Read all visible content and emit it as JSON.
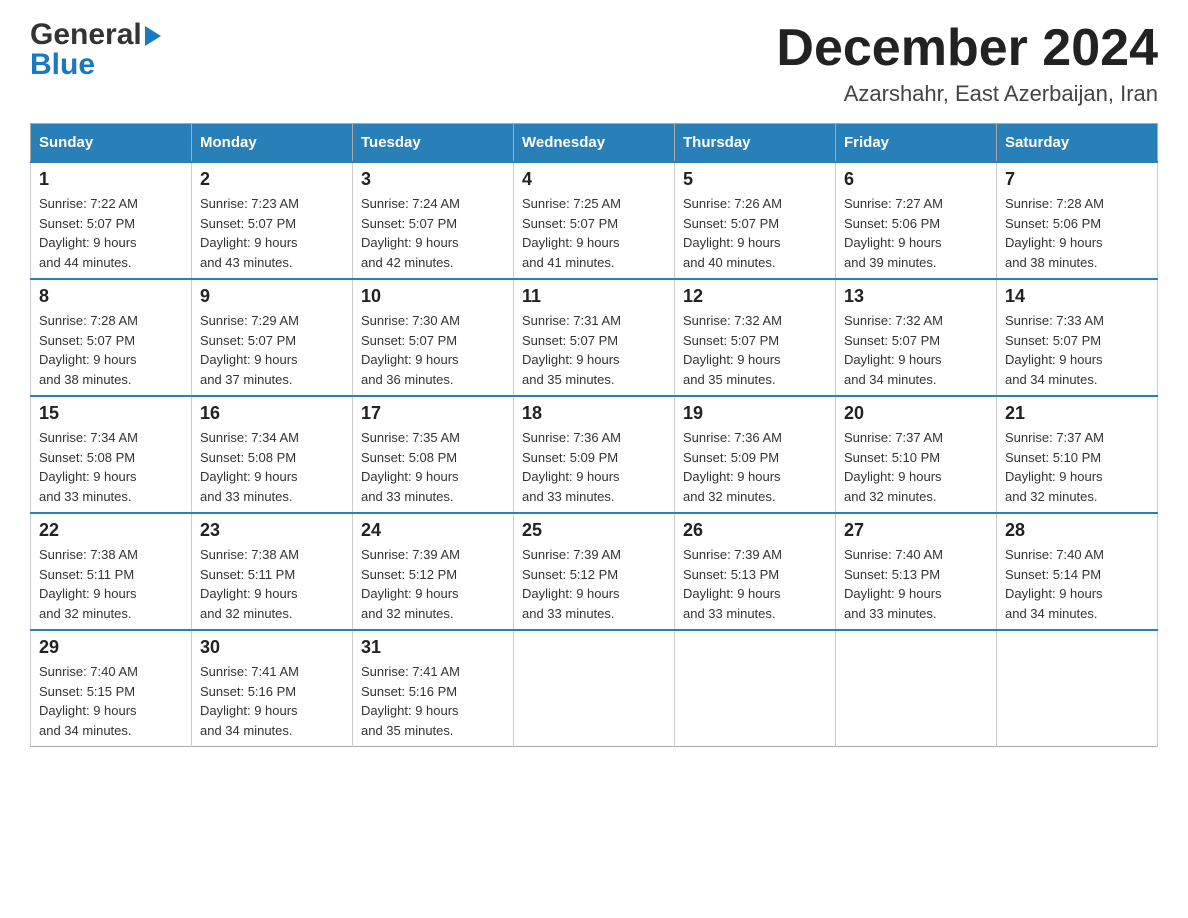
{
  "header": {
    "logo_general": "General",
    "logo_blue": "Blue",
    "month_title": "December 2024",
    "location": "Azarshahr, East Azerbaijan, Iran"
  },
  "weekdays": [
    "Sunday",
    "Monday",
    "Tuesday",
    "Wednesday",
    "Thursday",
    "Friday",
    "Saturday"
  ],
  "weeks": [
    [
      {
        "day": "1",
        "sunrise": "7:22 AM",
        "sunset": "5:07 PM",
        "daylight": "9 hours and 44 minutes."
      },
      {
        "day": "2",
        "sunrise": "7:23 AM",
        "sunset": "5:07 PM",
        "daylight": "9 hours and 43 minutes."
      },
      {
        "day": "3",
        "sunrise": "7:24 AM",
        "sunset": "5:07 PM",
        "daylight": "9 hours and 42 minutes."
      },
      {
        "day": "4",
        "sunrise": "7:25 AM",
        "sunset": "5:07 PM",
        "daylight": "9 hours and 41 minutes."
      },
      {
        "day": "5",
        "sunrise": "7:26 AM",
        "sunset": "5:07 PM",
        "daylight": "9 hours and 40 minutes."
      },
      {
        "day": "6",
        "sunrise": "7:27 AM",
        "sunset": "5:06 PM",
        "daylight": "9 hours and 39 minutes."
      },
      {
        "day": "7",
        "sunrise": "7:28 AM",
        "sunset": "5:06 PM",
        "daylight": "9 hours and 38 minutes."
      }
    ],
    [
      {
        "day": "8",
        "sunrise": "7:28 AM",
        "sunset": "5:07 PM",
        "daylight": "9 hours and 38 minutes."
      },
      {
        "day": "9",
        "sunrise": "7:29 AM",
        "sunset": "5:07 PM",
        "daylight": "9 hours and 37 minutes."
      },
      {
        "day": "10",
        "sunrise": "7:30 AM",
        "sunset": "5:07 PM",
        "daylight": "9 hours and 36 minutes."
      },
      {
        "day": "11",
        "sunrise": "7:31 AM",
        "sunset": "5:07 PM",
        "daylight": "9 hours and 35 minutes."
      },
      {
        "day": "12",
        "sunrise": "7:32 AM",
        "sunset": "5:07 PM",
        "daylight": "9 hours and 35 minutes."
      },
      {
        "day": "13",
        "sunrise": "7:32 AM",
        "sunset": "5:07 PM",
        "daylight": "9 hours and 34 minutes."
      },
      {
        "day": "14",
        "sunrise": "7:33 AM",
        "sunset": "5:07 PM",
        "daylight": "9 hours and 34 minutes."
      }
    ],
    [
      {
        "day": "15",
        "sunrise": "7:34 AM",
        "sunset": "5:08 PM",
        "daylight": "9 hours and 33 minutes."
      },
      {
        "day": "16",
        "sunrise": "7:34 AM",
        "sunset": "5:08 PM",
        "daylight": "9 hours and 33 minutes."
      },
      {
        "day": "17",
        "sunrise": "7:35 AM",
        "sunset": "5:08 PM",
        "daylight": "9 hours and 33 minutes."
      },
      {
        "day": "18",
        "sunrise": "7:36 AM",
        "sunset": "5:09 PM",
        "daylight": "9 hours and 33 minutes."
      },
      {
        "day": "19",
        "sunrise": "7:36 AM",
        "sunset": "5:09 PM",
        "daylight": "9 hours and 32 minutes."
      },
      {
        "day": "20",
        "sunrise": "7:37 AM",
        "sunset": "5:10 PM",
        "daylight": "9 hours and 32 minutes."
      },
      {
        "day": "21",
        "sunrise": "7:37 AM",
        "sunset": "5:10 PM",
        "daylight": "9 hours and 32 minutes."
      }
    ],
    [
      {
        "day": "22",
        "sunrise": "7:38 AM",
        "sunset": "5:11 PM",
        "daylight": "9 hours and 32 minutes."
      },
      {
        "day": "23",
        "sunrise": "7:38 AM",
        "sunset": "5:11 PM",
        "daylight": "9 hours and 32 minutes."
      },
      {
        "day": "24",
        "sunrise": "7:39 AM",
        "sunset": "5:12 PM",
        "daylight": "9 hours and 32 minutes."
      },
      {
        "day": "25",
        "sunrise": "7:39 AM",
        "sunset": "5:12 PM",
        "daylight": "9 hours and 33 minutes."
      },
      {
        "day": "26",
        "sunrise": "7:39 AM",
        "sunset": "5:13 PM",
        "daylight": "9 hours and 33 minutes."
      },
      {
        "day": "27",
        "sunrise": "7:40 AM",
        "sunset": "5:13 PM",
        "daylight": "9 hours and 33 minutes."
      },
      {
        "day": "28",
        "sunrise": "7:40 AM",
        "sunset": "5:14 PM",
        "daylight": "9 hours and 34 minutes."
      }
    ],
    [
      {
        "day": "29",
        "sunrise": "7:40 AM",
        "sunset": "5:15 PM",
        "daylight": "9 hours and 34 minutes."
      },
      {
        "day": "30",
        "sunrise": "7:41 AM",
        "sunset": "5:16 PM",
        "daylight": "9 hours and 34 minutes."
      },
      {
        "day": "31",
        "sunrise": "7:41 AM",
        "sunset": "5:16 PM",
        "daylight": "9 hours and 35 minutes."
      },
      null,
      null,
      null,
      null
    ]
  ],
  "labels": {
    "sunrise": "Sunrise:",
    "sunset": "Sunset:",
    "daylight": "Daylight:"
  }
}
